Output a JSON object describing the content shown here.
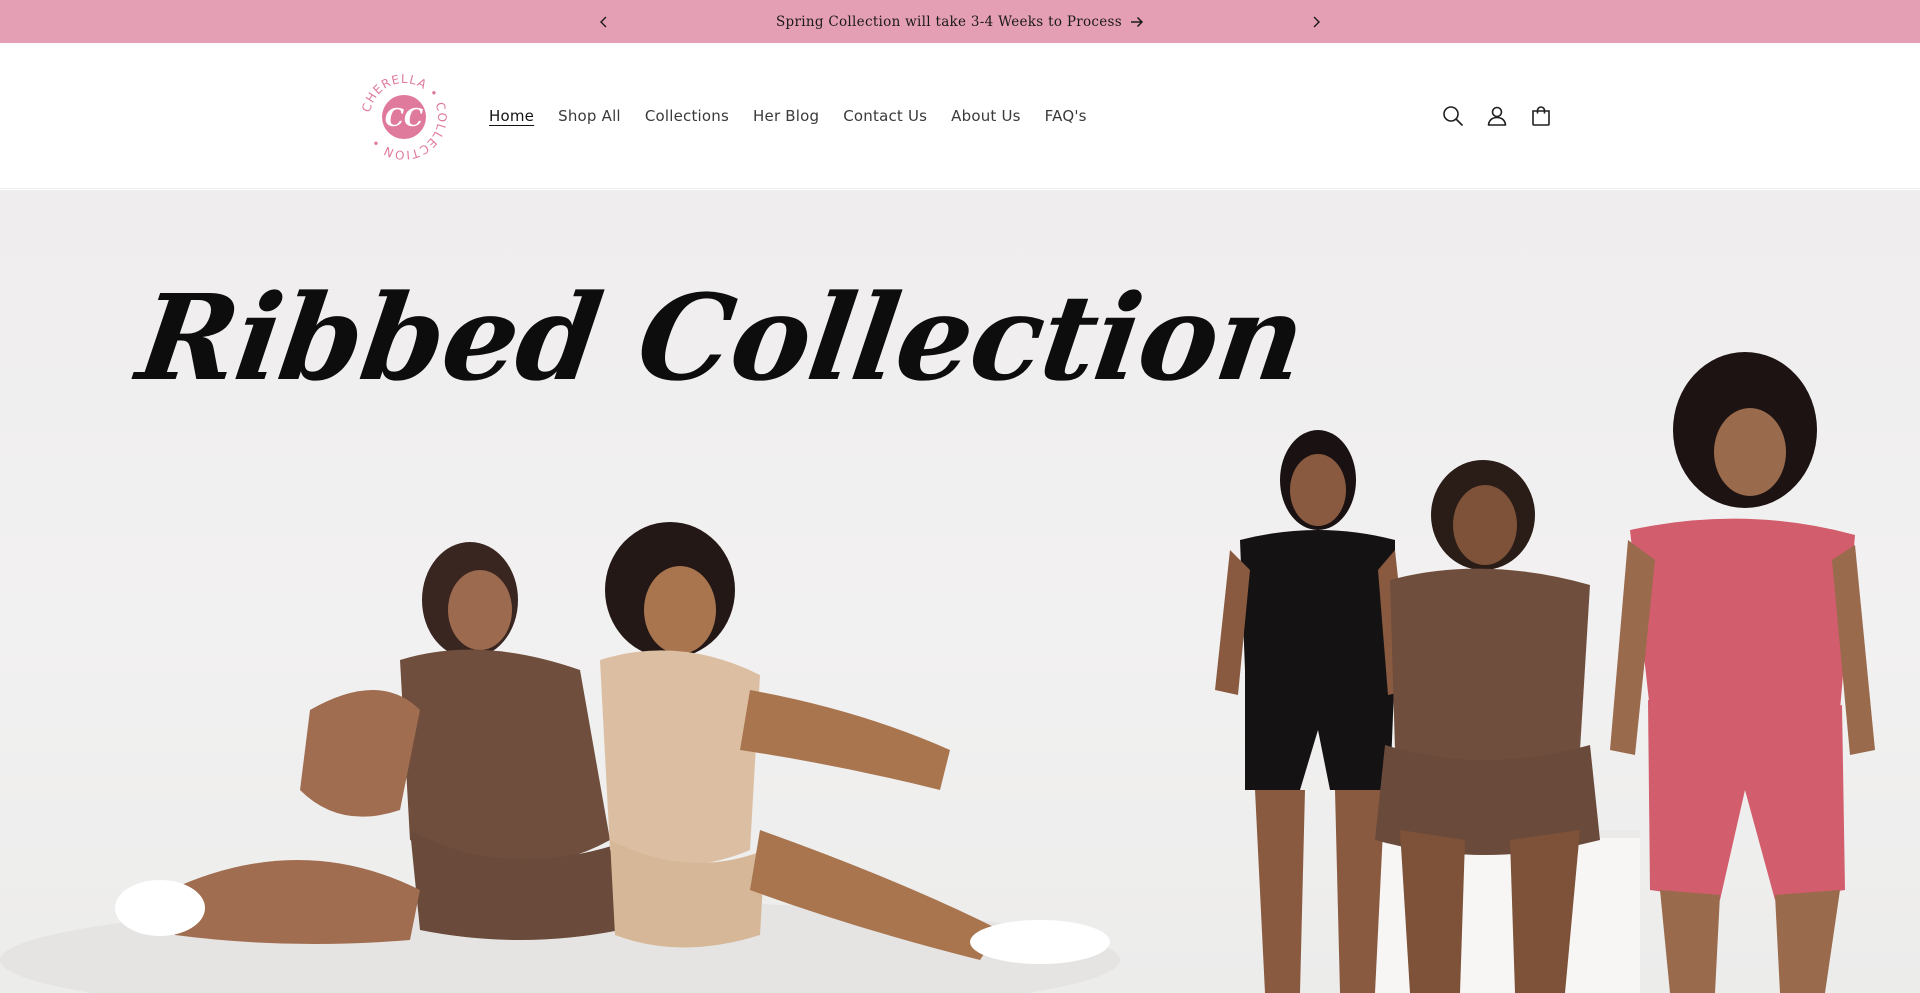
{
  "announcement": {
    "message": "Spring Collection will take 3-4 Weeks to Process",
    "prev_icon": "chevron-left-icon",
    "next_icon": "chevron-right-icon",
    "link_icon": "arrow-right-icon",
    "background": "#e59fb4"
  },
  "header": {
    "logo_text": "CHERELLA COLLECTION",
    "logo_monogram": "CC",
    "logo_color": "#e07a9c",
    "nav": [
      {
        "label": "Home",
        "active": true
      },
      {
        "label": "Shop All",
        "active": false
      },
      {
        "label": "Collections",
        "active": false
      },
      {
        "label": "Her Blog",
        "active": false
      },
      {
        "label": "Contact Us",
        "active": false
      },
      {
        "label": "About Us",
        "active": false
      },
      {
        "label": "FAQ's",
        "active": false
      }
    ],
    "icons": [
      "search-icon",
      "account-icon",
      "cart-icon"
    ]
  },
  "hero": {
    "title": "Ribbed Collection",
    "image_description_colors": {
      "brown": "#6f4e3d",
      "tan": "#dcbfa2",
      "black": "#151214",
      "pink": "#d25d6c"
    }
  }
}
